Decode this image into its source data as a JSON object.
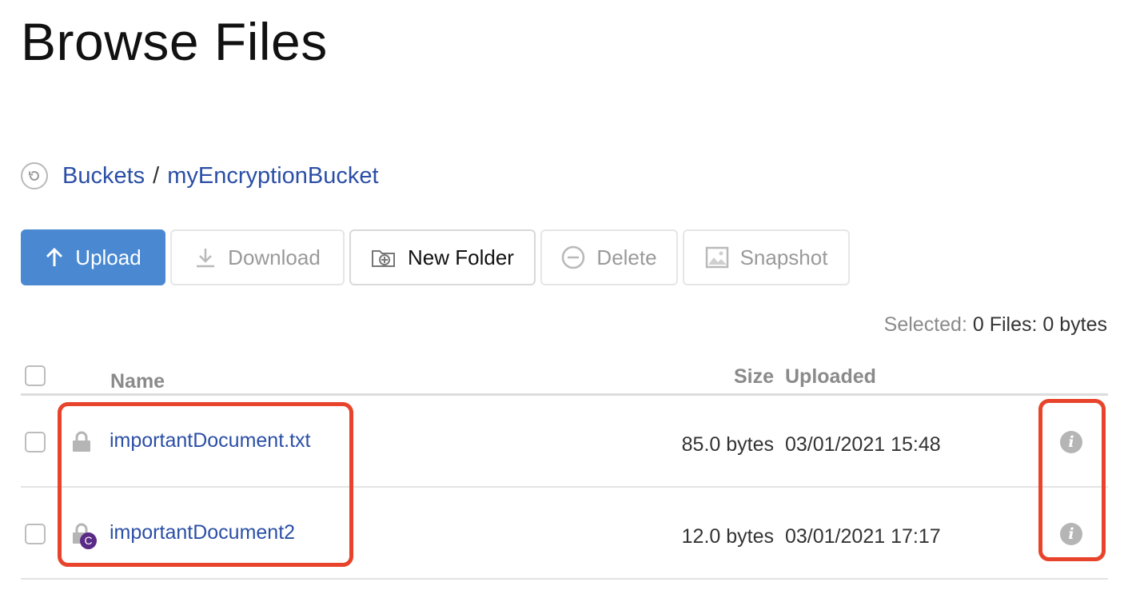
{
  "page": {
    "title": "Browse Files"
  },
  "breadcrumb": {
    "back_icon": "back-arrow-circle-icon",
    "root": "Buckets",
    "separator": "/",
    "current": "myEncryptionBucket"
  },
  "toolbar": {
    "upload": {
      "label": "Upload",
      "icon": "arrow-up-icon"
    },
    "download": {
      "label": "Download",
      "icon": "download-icon"
    },
    "new_folder": {
      "label": "New Folder",
      "icon": "folder-plus-icon"
    },
    "delete": {
      "label": "Delete",
      "icon": "minus-circle-icon"
    },
    "snapshot": {
      "label": "Snapshot",
      "icon": "image-icon"
    }
  },
  "selection": {
    "label": "Selected:",
    "value": "0 Files: 0 bytes"
  },
  "table": {
    "columns": {
      "name": "Name",
      "size": "Size",
      "uploaded": "Uploaded"
    },
    "rows": [
      {
        "name": "importantDocument.txt",
        "size": "85.0 bytes",
        "uploaded": "03/01/2021 15:48",
        "lock_icon": "lock-icon"
      },
      {
        "name": "importantDocument2",
        "size": "12.0 bytes",
        "uploaded": "03/01/2021 17:17",
        "lock_icon": "lock-icon",
        "badge": "C"
      }
    ]
  },
  "info_icon": {
    "glyph": "i"
  },
  "colors": {
    "primary": "#4a89d2",
    "link": "#2b4fa6",
    "highlight": "#e8432b",
    "badge": "#5b2a86"
  }
}
